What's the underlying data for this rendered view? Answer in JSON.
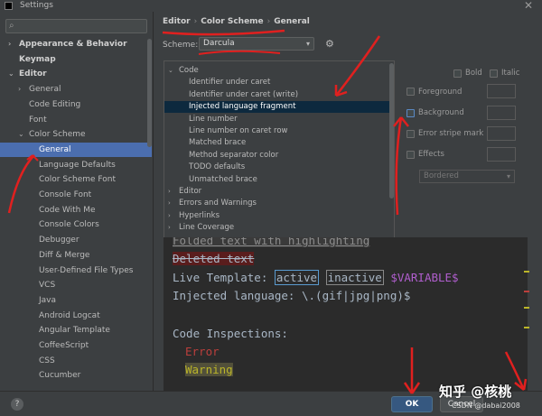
{
  "window": {
    "title": "Settings",
    "close_glyph": "✕",
    "app_icon": "app-icon"
  },
  "search": {
    "placeholder": "",
    "icon": "search-icon"
  },
  "sidebar": {
    "items": [
      {
        "label": "Appearance & Behavior",
        "level": 0,
        "arrow": "›",
        "bold": true
      },
      {
        "label": "Keymap",
        "level": 0,
        "arrow": "",
        "bold": true
      },
      {
        "label": "Editor",
        "level": 0,
        "arrow": "⌄",
        "bold": true
      },
      {
        "label": "General",
        "level": 1,
        "arrow": "›"
      },
      {
        "label": "Code Editing",
        "level": 1,
        "arrow": ""
      },
      {
        "label": "Font",
        "level": 1,
        "arrow": ""
      },
      {
        "label": "Color Scheme",
        "level": 1,
        "arrow": "⌄"
      },
      {
        "label": "General",
        "level": 2,
        "arrow": "",
        "selected": true
      },
      {
        "label": "Language Defaults",
        "level": 2,
        "arrow": ""
      },
      {
        "label": "Color Scheme Font",
        "level": 2,
        "arrow": ""
      },
      {
        "label": "Console Font",
        "level": 2,
        "arrow": ""
      },
      {
        "label": "Code With Me",
        "level": 2,
        "arrow": ""
      },
      {
        "label": "Console Colors",
        "level": 2,
        "arrow": ""
      },
      {
        "label": "Debugger",
        "level": 2,
        "arrow": ""
      },
      {
        "label": "Diff & Merge",
        "level": 2,
        "arrow": ""
      },
      {
        "label": "User-Defined File Types",
        "level": 2,
        "arrow": ""
      },
      {
        "label": "VCS",
        "level": 2,
        "arrow": ""
      },
      {
        "label": "Java",
        "level": 2,
        "arrow": ""
      },
      {
        "label": "Android Logcat",
        "level": 2,
        "arrow": ""
      },
      {
        "label": "Angular Template",
        "level": 2,
        "arrow": ""
      },
      {
        "label": "CoffeeScript",
        "level": 2,
        "arrow": ""
      },
      {
        "label": "CSS",
        "level": 2,
        "arrow": ""
      },
      {
        "label": "Cucumber",
        "level": 2,
        "arrow": ""
      }
    ]
  },
  "breadcrumb": {
    "items": [
      "Editor",
      "Color Scheme",
      "General"
    ],
    "separator": "›"
  },
  "scheme": {
    "label": "Scheme:",
    "value": "Darcula",
    "dropdown_glyph": "▾",
    "gear_glyph": "⚙"
  },
  "options_tree": {
    "items": [
      {
        "label": "Code",
        "level": 0,
        "arrow": "⌄"
      },
      {
        "label": "Identifier under caret",
        "level": 1
      },
      {
        "label": "Identifier under caret (write)",
        "level": 1
      },
      {
        "label": "Injected language fragment",
        "level": 1,
        "selected": true
      },
      {
        "label": "Line number",
        "level": 1
      },
      {
        "label": "Line number on caret row",
        "level": 1
      },
      {
        "label": "Matched brace",
        "level": 1
      },
      {
        "label": "Method separator color",
        "level": 1
      },
      {
        "label": "TODO defaults",
        "level": 1
      },
      {
        "label": "Unmatched brace",
        "level": 1
      },
      {
        "label": "Editor",
        "level": 0,
        "arrow": "›"
      },
      {
        "label": "Errors and Warnings",
        "level": 0,
        "arrow": "›"
      },
      {
        "label": "Hyperlinks",
        "level": 0,
        "arrow": "›"
      },
      {
        "label": "Line Coverage",
        "level": 0,
        "arrow": "›"
      }
    ]
  },
  "attributes": {
    "bold": "Bold",
    "italic": "Italic",
    "foreground": "Foreground",
    "background": "Background",
    "error_stripe": "Error stripe mark",
    "effects": "Effects",
    "effect_type": "Bordered",
    "dropdown_glyph": "▾"
  },
  "preview": {
    "folded": "Folded text with highlighting",
    "deleted": "Deleted text",
    "live_template_prefix": "Live Template: ",
    "active": "active",
    "inactive": "inactive",
    "variable": "$VARIABLE$",
    "injected": "Injected language: \\.(gif|jpg|png)$",
    "inspections": "Code Inspections:",
    "error": "Error",
    "warning": "Warning"
  },
  "buttons": {
    "ok": "OK",
    "cancel": "Cancel",
    "help": "?"
  },
  "watermark": {
    "main": "知乎 @核桃",
    "sub": "CSDN @dabai2008"
  },
  "colors": {
    "accent_selected": "#4b6eaf",
    "ok_button": "#365880",
    "annotation_red": "#e0201f",
    "preview_bg": "#2b2b2b"
  }
}
